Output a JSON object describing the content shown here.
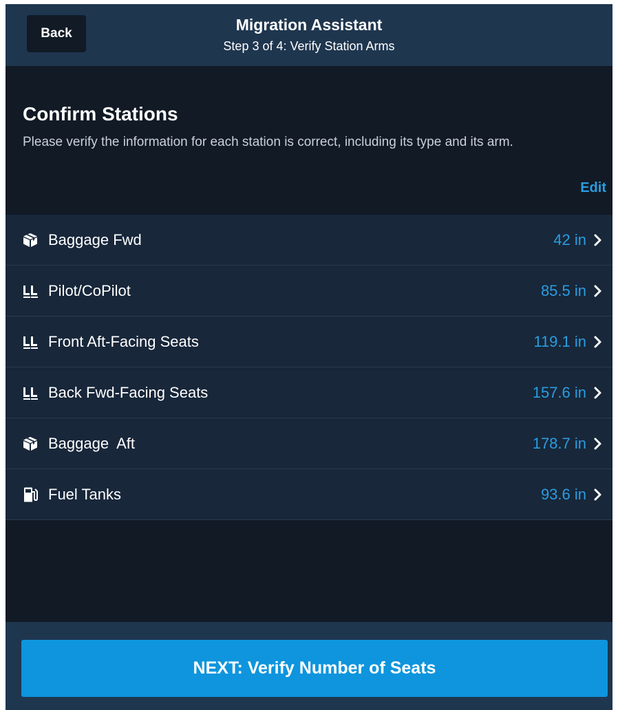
{
  "header": {
    "back_label": "Back",
    "title": "Migration Assistant",
    "subtitle": "Step 3 of 4: Verify Station Arms"
  },
  "intro": {
    "title": "Confirm Stations",
    "description": "Please verify the information for each station is correct, including its type and its arm.",
    "edit_label": "Edit"
  },
  "stations": [
    {
      "label": "Baggage Fwd",
      "value": "42 in",
      "icon": "baggage-box-icon"
    },
    {
      "label": "Pilot/CoPilot",
      "value": "85.5 in",
      "icon": "seats-icon"
    },
    {
      "label": "Front Aft-Facing Seats",
      "value": "119.1 in",
      "icon": "seats-icon"
    },
    {
      "label": "Back Fwd-Facing Seats",
      "value": "157.6 in",
      "icon": "seats-icon"
    },
    {
      "label": "Baggage  Aft",
      "value": "178.7 in",
      "icon": "baggage-box-icon"
    },
    {
      "label": "Fuel Tanks",
      "value": "93.6 in",
      "icon": "fuel-pump-icon"
    }
  ],
  "footer": {
    "next_label": "NEXT: Verify Number of Seats"
  },
  "colors": {
    "header_bg": "#1f364f",
    "page_bg": "#111a25",
    "list_bg": "#18273a",
    "accent": "#2a9de1",
    "button": "#0e95dd"
  }
}
